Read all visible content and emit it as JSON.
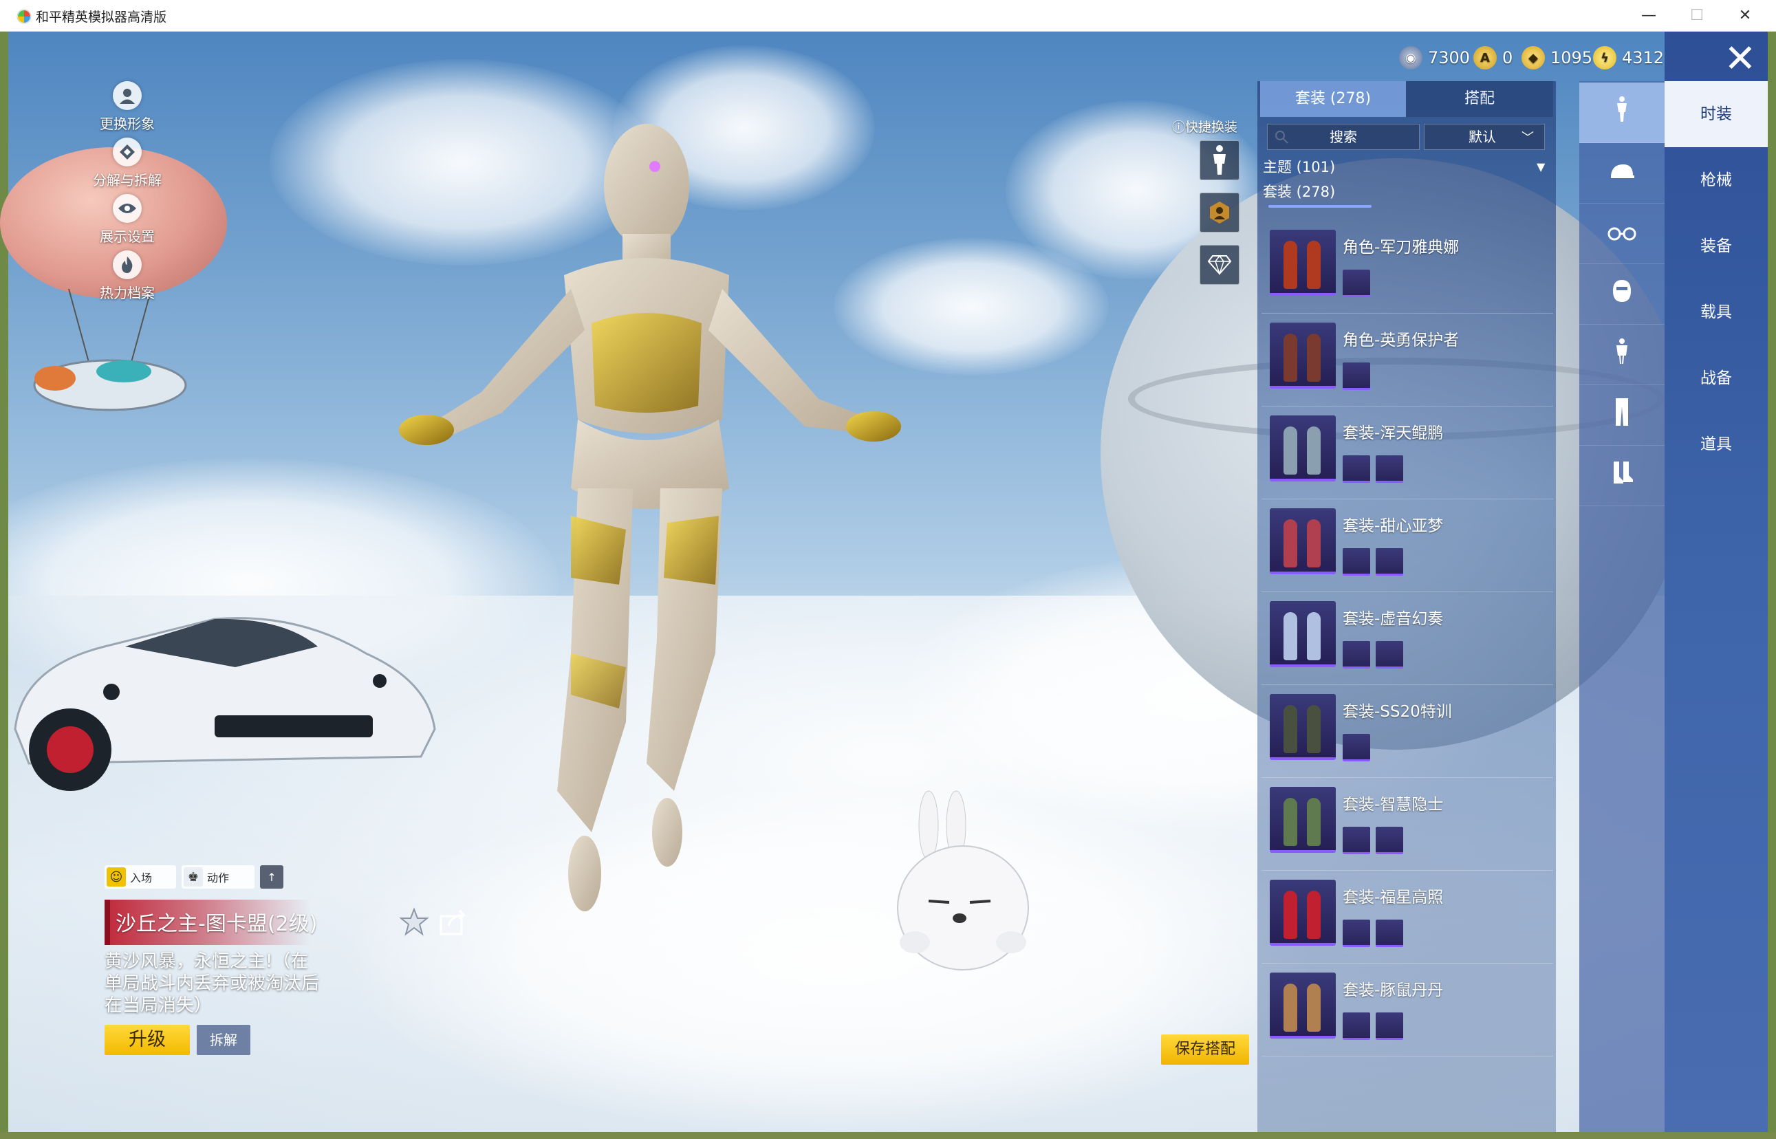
{
  "window": {
    "title": "和平精英模拟器高清版",
    "min_glyph": "—",
    "max_glyph": "☐",
    "close_glyph": "✕"
  },
  "left_menu": [
    {
      "label": "更换形象",
      "icon": "avatar-icon"
    },
    {
      "label": "分解与拆解",
      "icon": "split-icon"
    },
    {
      "label": "展示设置",
      "icon": "eye-icon"
    },
    {
      "label": "热力档案",
      "icon": "flame-icon"
    }
  ],
  "currencies": [
    {
      "value": "7300",
      "icon": "coin-icon",
      "color": "#5a6e9a"
    },
    {
      "value": "0",
      "icon": "a-coin-icon",
      "color": "#c89a20"
    },
    {
      "value": "1095",
      "icon": "gold-coin-icon",
      "color": "#d7a31a"
    },
    {
      "value": "4312",
      "icon": "bolt-coin-icon",
      "color": "#e2b81a"
    }
  ],
  "close_glyph": "✕",
  "quick_change": {
    "label": "快捷换装"
  },
  "actions": {
    "entrance": "入场",
    "motion": "动作",
    "arrow": "↑"
  },
  "item": {
    "name": "沙丘之主-图卡盟(2级)",
    "description": "黄沙风暴，永恒之主!（在单局战斗内丢弃或被淘汰后在当局消失）",
    "upgrade": "升级",
    "split": "拆解"
  },
  "save_button": "保存搭配",
  "panel": {
    "tabs": [
      "套装 (278)",
      "搭配"
    ],
    "search_placeholder": "搜索",
    "sort_value": "默认",
    "theme": "主题 (101)",
    "suit_count": "套装 (278)",
    "items": [
      {
        "name": "角色-军刀雅典娜",
        "minis": 1,
        "color": "#b03a20"
      },
      {
        "name": "角色-英勇保护者",
        "minis": 1,
        "color": "#7a3a30"
      },
      {
        "name": "套装-浑天鲲鹏",
        "minis": 2,
        "color": "#8aa0b0"
      },
      {
        "name": "套装-甜心亚梦",
        "minis": 2,
        "color": "#b04050"
      },
      {
        "name": "套装-虚音幻奏",
        "minis": 2,
        "color": "#b0c0e0"
      },
      {
        "name": "套装-SS20特训",
        "minis": 1,
        "color": "#4a5040"
      },
      {
        "name": "套装-智慧隐士",
        "minis": 2,
        "color": "#607a50"
      },
      {
        "name": "套装-福星高照",
        "minis": 2,
        "color": "#c02030"
      },
      {
        "name": "套装-豚鼠丹丹",
        "minis": 2,
        "color": "#b08050"
      }
    ]
  },
  "icon_column": [
    {
      "icon": "character-icon",
      "selected": true
    },
    {
      "icon": "cap-icon",
      "selected": false
    },
    {
      "icon": "glasses-icon",
      "selected": false
    },
    {
      "icon": "mask-icon",
      "selected": false
    },
    {
      "icon": "top-icon",
      "selected": false
    },
    {
      "icon": "pants-icon",
      "selected": false
    },
    {
      "icon": "shoes-icon",
      "selected": false
    }
  ],
  "categories": [
    {
      "label": "时装",
      "selected": true
    },
    {
      "label": "枪械",
      "selected": false
    },
    {
      "label": "装备",
      "selected": false
    },
    {
      "label": "载具",
      "selected": false
    },
    {
      "label": "战备",
      "selected": false
    },
    {
      "label": "道具",
      "selected": false
    }
  ]
}
